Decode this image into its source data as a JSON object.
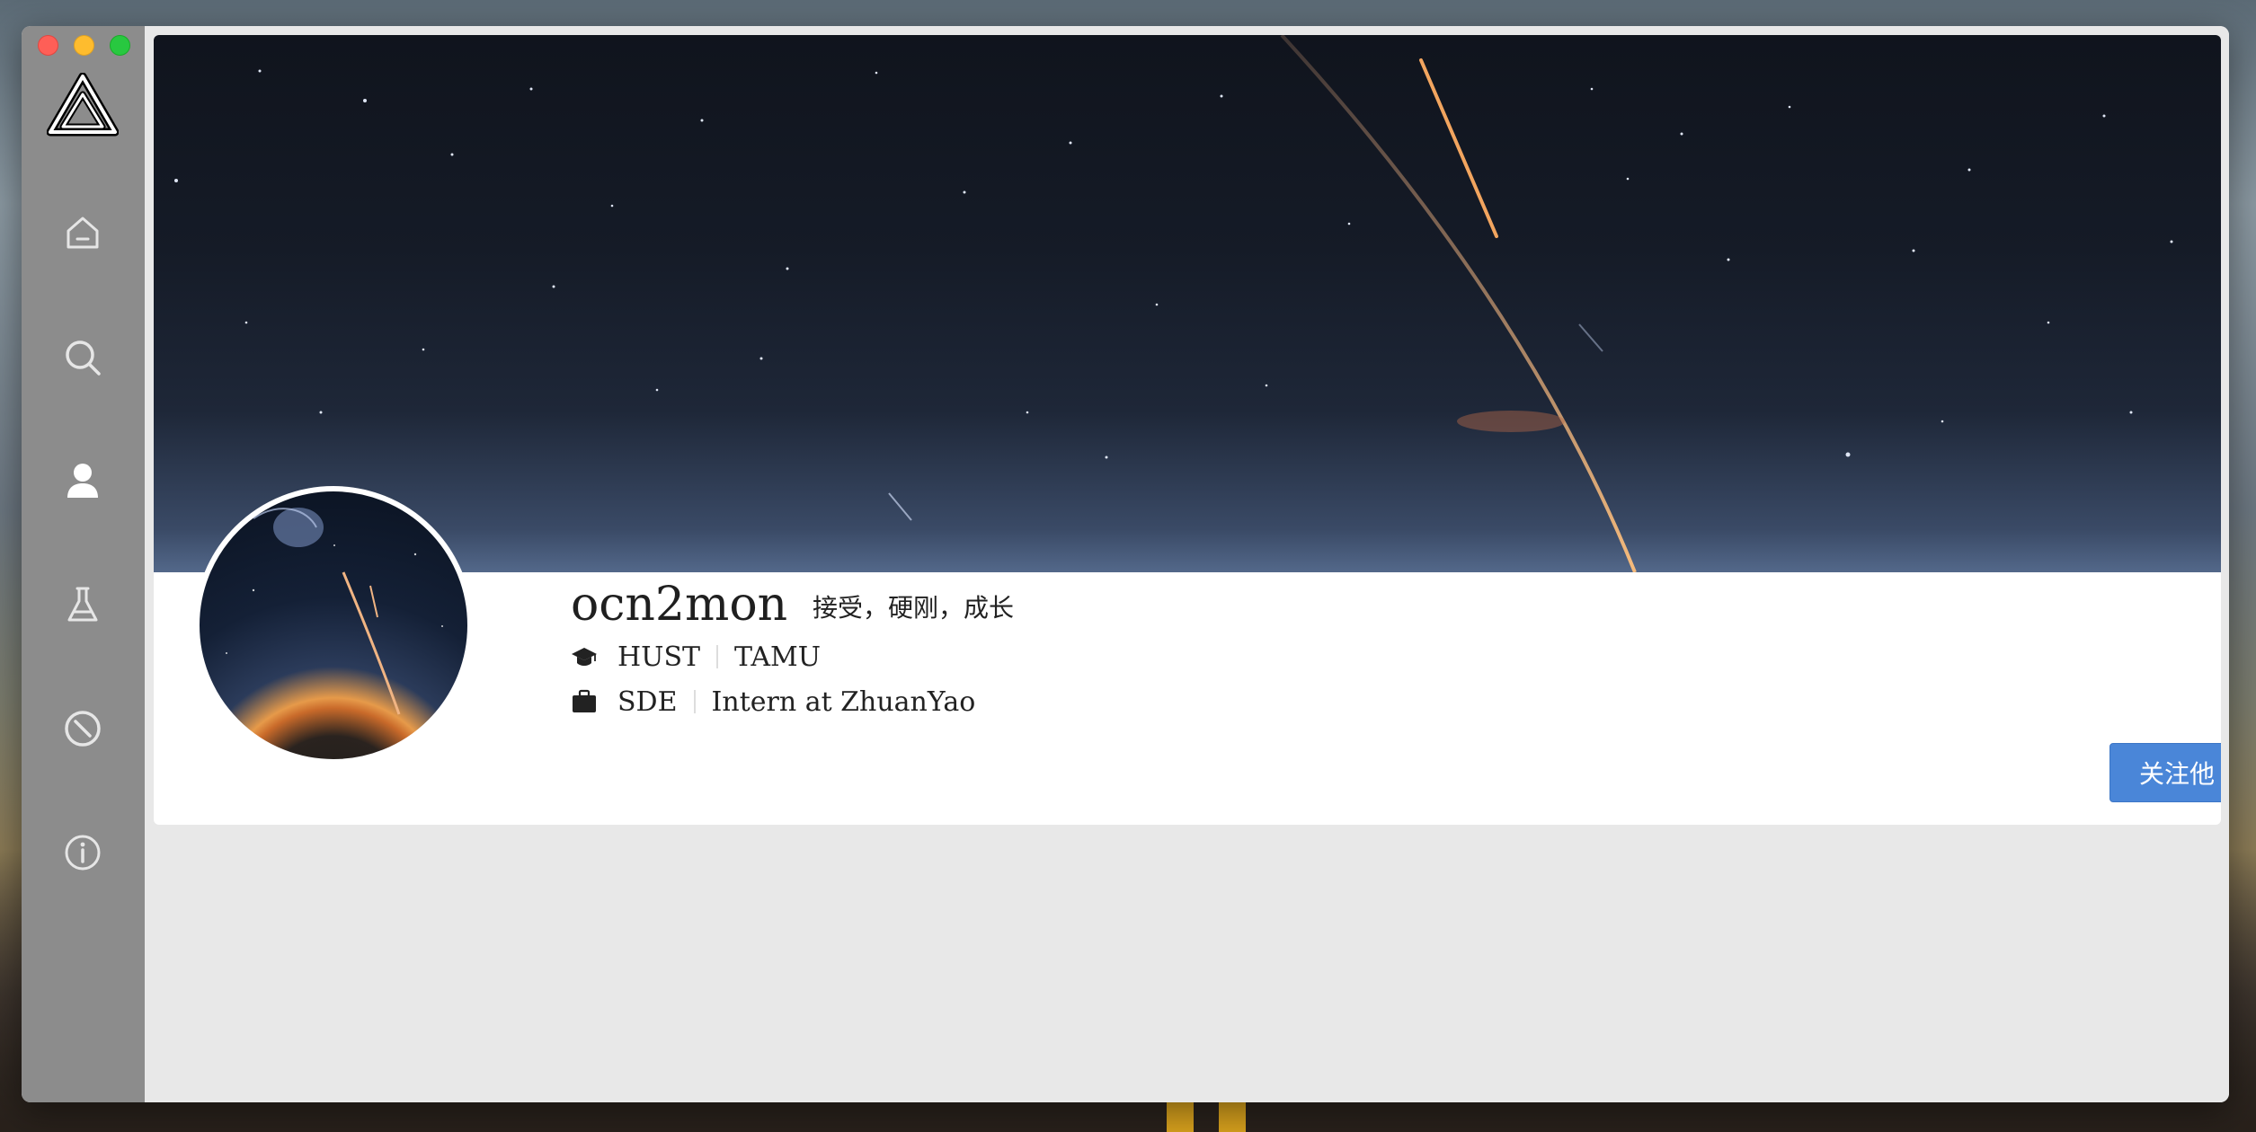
{
  "window": {
    "controls": [
      "close",
      "minimize",
      "zoom"
    ]
  },
  "sidebar": {
    "logo_icon": "triangle-logo-icon",
    "items": [
      {
        "id": "home",
        "icon": "home-icon"
      },
      {
        "id": "search",
        "icon": "search-icon"
      },
      {
        "id": "profile",
        "icon": "user-icon",
        "active": true
      },
      {
        "id": "lab",
        "icon": "flask-icon"
      },
      {
        "id": "blocked",
        "icon": "block-icon"
      },
      {
        "id": "about",
        "icon": "info-icon"
      }
    ]
  },
  "profile": {
    "username": "ocn2mon",
    "motto": "接受，硬刚，成长",
    "education": {
      "icon": "graduation-cap-icon",
      "schools": [
        "HUST",
        "TAMU"
      ]
    },
    "work": {
      "icon": "briefcase-icon",
      "title": "SDE",
      "position": "Intern at ZhuanYao"
    },
    "follow_button": "关注他"
  },
  "colors": {
    "sidebar": "#8c8c8c",
    "button": "#4a86d8",
    "background": "#e8e8e8"
  }
}
